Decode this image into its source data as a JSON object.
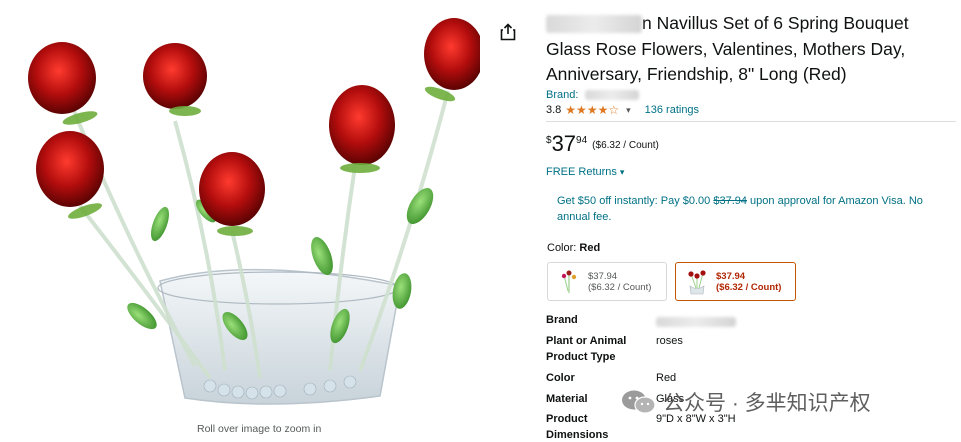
{
  "image": {
    "zoom_hint": "Roll over image to zoom in",
    "share_icon": "share-icon"
  },
  "product": {
    "title_rest": "n Navillus Set of 6 Spring Bouquet Glass Rose Flowers, Valentines, Mothers Day, Anniversary, Friendship, 8\" Long (Red)",
    "brand_label": "Brand:",
    "rating_value": "3.8",
    "rating_fraction": 0.76,
    "stars": "★★★★☆",
    "ratings_count": "136 ratings"
  },
  "price": {
    "symbol": "$",
    "whole": "37",
    "fraction": "94",
    "per_unit": "($6.32 / Count)"
  },
  "returns": {
    "label": "FREE Returns",
    "chevron": "▾"
  },
  "promo": {
    "text_before": "Get $50 off instantly: Pay $0.00 ",
    "strike_price": "$37.94",
    "text_after": " upon approval for Amazon Visa. No annual fee."
  },
  "color": {
    "label": "Color:",
    "selected": "Red",
    "options": [
      {
        "price": "$37.94",
        "per_unit": "($6.32 / Count)"
      },
      {
        "price": "$37.94",
        "per_unit": "($6.32 / Count)"
      }
    ]
  },
  "specs": [
    {
      "key": "Brand",
      "value": ""
    },
    {
      "key": "Plant or Animal Product Type",
      "value": "roses"
    },
    {
      "key": "Color",
      "value": "Red"
    },
    {
      "key": "Material",
      "value": "Glass"
    },
    {
      "key": "Product Dimensions",
      "value": "9\"D x 8\"W x 3\"H"
    }
  ],
  "watermark": {
    "text": "公众号 · 多芈知识产权"
  },
  "colors": {
    "link": "#007185",
    "star": "#de7921",
    "deal": "#b12704",
    "selected_border": "#c45500"
  }
}
